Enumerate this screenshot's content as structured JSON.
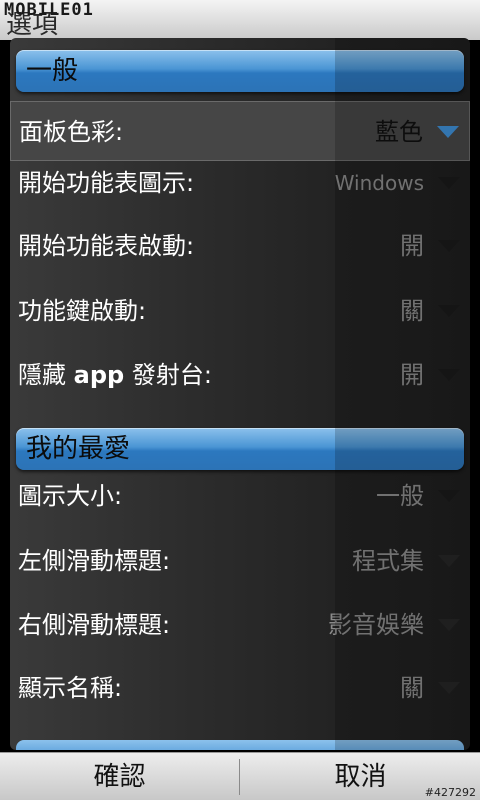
{
  "watermark_logo": "MOBILE01",
  "window_title": "選項",
  "sections": {
    "general": {
      "header": "一般",
      "rows": [
        {
          "label": "面板色彩:",
          "value": "藍色"
        },
        {
          "label": "開始功能表圖示:",
          "value": "Windows"
        },
        {
          "label": "開始功能表啟動:",
          "value": "開"
        },
        {
          "label": "功能鍵啟動:",
          "value": "關"
        },
        {
          "label_prefix": "隱藏 ",
          "label_bold": "app",
          "label_suffix": " 發射台:",
          "value": "開"
        }
      ]
    },
    "favorites": {
      "header": "我的最愛",
      "rows": [
        {
          "label": "圖示大小:",
          "value": "一般"
        },
        {
          "label": "左側滑動標題:",
          "value": "程式集"
        },
        {
          "label": "右側滑動標題:",
          "value": "影音娛樂"
        },
        {
          "label": "顯示名稱:",
          "value": "關"
        }
      ]
    }
  },
  "bottom_bar": {
    "confirm_label": "確認",
    "cancel_label": "取消"
  },
  "watermark_id": "#427292",
  "colors": {
    "accent": "#3f8fd6",
    "header_gradient_top": "#8cc1ec",
    "header_gradient_bottom": "#2c73b6"
  },
  "icons": {
    "dropdown": "triangle-down"
  }
}
